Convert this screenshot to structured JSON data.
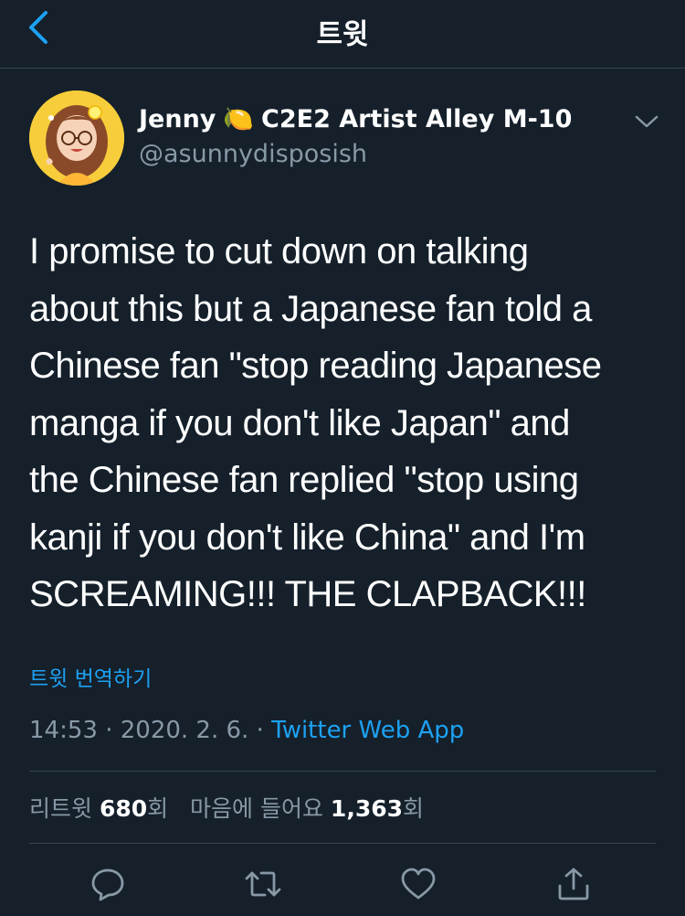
{
  "header": {
    "title": "트윗",
    "back_icon": "chevron-left-icon"
  },
  "colors": {
    "background": "#15202b",
    "accent": "#1da1f2",
    "muted": "#8899a6",
    "divider": "#38444d"
  },
  "author": {
    "name": "Jenny",
    "emoji": "🍋",
    "name_suffix": "C2E2 Artist Alley M-10",
    "handle": "@asunnydisposish"
  },
  "tweet": {
    "lines": [
      "I promise to cut down on talking",
      "about this but a Japanese fan told a",
      "Chinese fan \"stop reading Japanese",
      "manga if you don't like Japan\" and",
      "the Chinese fan replied \"stop using",
      "kanji if you don't like China\" and I'm",
      "SCREAMING!!! THE CLAPBACK!!!"
    ],
    "translate_label": "트윗 번역하기",
    "time": "14:53",
    "separator": "·",
    "date": "2020. 2. 6.",
    "source": "Twitter Web App"
  },
  "stats": {
    "retweets_label": "리트윗",
    "retweets_count": "680",
    "retweets_unit": "회",
    "likes_label": "마음에 들어요",
    "likes_count": "1,363",
    "likes_unit": "회"
  },
  "actions": [
    "reply-icon",
    "retweet-icon",
    "like-icon",
    "share-icon"
  ]
}
